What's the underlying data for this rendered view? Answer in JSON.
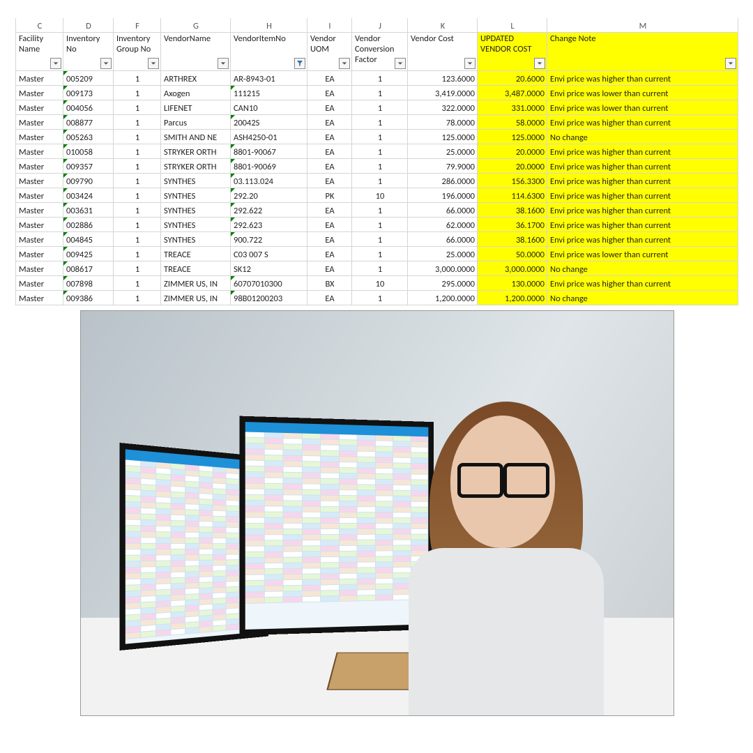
{
  "columns": {
    "letters": [
      "C",
      "D",
      "F",
      "G",
      "H",
      "I",
      "J",
      "K",
      "L",
      "M"
    ],
    "headers": {
      "C": "Facility Name",
      "D": "Inventory No",
      "F": "Inventory Group No",
      "G": "VendorName",
      "H": "VendorItemNo",
      "I": "Vendor UOM",
      "J": "Vendor Conversion Factor",
      "K": "Vendor Cost",
      "L": "UPDATED VENDOR COST",
      "M": "Change Note"
    }
  },
  "rows": [
    {
      "C": "Master",
      "D": "005209",
      "F": "1",
      "G": "ARTHREX",
      "H": "AR-8943-01",
      "I": "EA",
      "J": "1",
      "K": "123.6000",
      "L": "20.6000",
      "M": "Envi price was higher than current"
    },
    {
      "C": "Master",
      "D": "009173",
      "F": "1",
      "G": "Axogen",
      "H": "111215",
      "I": "EA",
      "J": "1",
      "K": "3,419.0000",
      "L": "3,487.0000",
      "M": "Envi price was lower than current"
    },
    {
      "C": "Master",
      "D": "004056",
      "F": "1",
      "G": "LIFENET",
      "H": "CAN10",
      "I": "EA",
      "J": "1",
      "K": "322.0000",
      "L": "331.0000",
      "M": "Envi price was lower than current"
    },
    {
      "C": "Master",
      "D": "008877",
      "F": "1",
      "G": "Parcus",
      "H": "20042S",
      "I": "EA",
      "J": "1",
      "K": "78.0000",
      "L": "58.0000",
      "M": "Envi price was higher than current"
    },
    {
      "C": "Master",
      "D": "005263",
      "F": "1",
      "G": "SMITH AND NE",
      "H": "ASH4250-01",
      "I": "EA",
      "J": "1",
      "K": "125.0000",
      "L": "125.0000",
      "M": "No change"
    },
    {
      "C": "Master",
      "D": "010058",
      "F": "1",
      "G": "STRYKER ORTH",
      "H": "8801-90067",
      "I": "EA",
      "J": "1",
      "K": "25.0000",
      "L": "20.0000",
      "M": "Envi price was higher than current"
    },
    {
      "C": "Master",
      "D": "009357",
      "F": "1",
      "G": "STRYKER ORTH",
      "H": "8801-90069",
      "I": "EA",
      "J": "1",
      "K": "79.9000",
      "L": "20.0000",
      "M": "Envi price was higher than current"
    },
    {
      "C": "Master",
      "D": "009790",
      "F": "1",
      "G": "SYNTHES",
      "H": "03.113.024",
      "I": "EA",
      "J": "1",
      "K": "286.0000",
      "L": "156.3300",
      "M": "Envi price was higher than current"
    },
    {
      "C": "Master",
      "D": "003424",
      "F": "1",
      "G": "SYNTHES",
      "H": "292.20",
      "I": "PK",
      "J": "10",
      "K": "196.0000",
      "L": "114.6300",
      "M": "Envi price was higher than current"
    },
    {
      "C": "Master",
      "D": "003631",
      "F": "1",
      "G": "SYNTHES",
      "H": "292.622",
      "I": "EA",
      "J": "1",
      "K": "66.0000",
      "L": "38.1600",
      "M": "Envi price was higher than current"
    },
    {
      "C": "Master",
      "D": "002886",
      "F": "1",
      "G": "SYNTHES",
      "H": "292.623",
      "I": "EA",
      "J": "1",
      "K": "62.0000",
      "L": "36.1700",
      "M": "Envi price was higher than current"
    },
    {
      "C": "Master",
      "D": "004845",
      "F": "1",
      "G": "SYNTHES",
      "H": "900.722",
      "I": "EA",
      "J": "1",
      "K": "66.0000",
      "L": "38.1600",
      "M": "Envi price was higher than current"
    },
    {
      "C": "Master",
      "D": "009425",
      "F": "1",
      "G": "TREACE",
      "H": "C03 007 S",
      "I": "EA",
      "J": "1",
      "K": "25.0000",
      "L": "50.0000",
      "M": "Envi price was lower than current"
    },
    {
      "C": "Master",
      "D": "008617",
      "F": "1",
      "G": "TREACE",
      "H": "SK12",
      "I": "EA",
      "J": "1",
      "K": "3,000.0000",
      "L": "3,000.0000",
      "M": "No change"
    },
    {
      "C": "Master",
      "D": "007898",
      "F": "1",
      "G": "ZIMMER US, IN",
      "H": "60707010300",
      "I": "BX",
      "J": "10",
      "K": "295.0000",
      "L": "130.0000",
      "M": "Envi price was higher than current"
    },
    {
      "C": "Master",
      "D": "009386",
      "F": "1",
      "G": "ZIMMER US, IN",
      "H": "98B01200203",
      "I": "EA",
      "J": "1",
      "K": "1,200.0000",
      "L": "1,200.0000",
      "M": "No change"
    }
  ],
  "highlightCols": [
    "L",
    "M"
  ],
  "filterColumns": [
    "C",
    "D",
    "F",
    "G",
    "H",
    "I",
    "J",
    "K",
    "L",
    "M"
  ],
  "activeFilterColumn": "H",
  "photo_alt": "Woman with glasses sitting at desk with two monitors showing spreadsheets"
}
